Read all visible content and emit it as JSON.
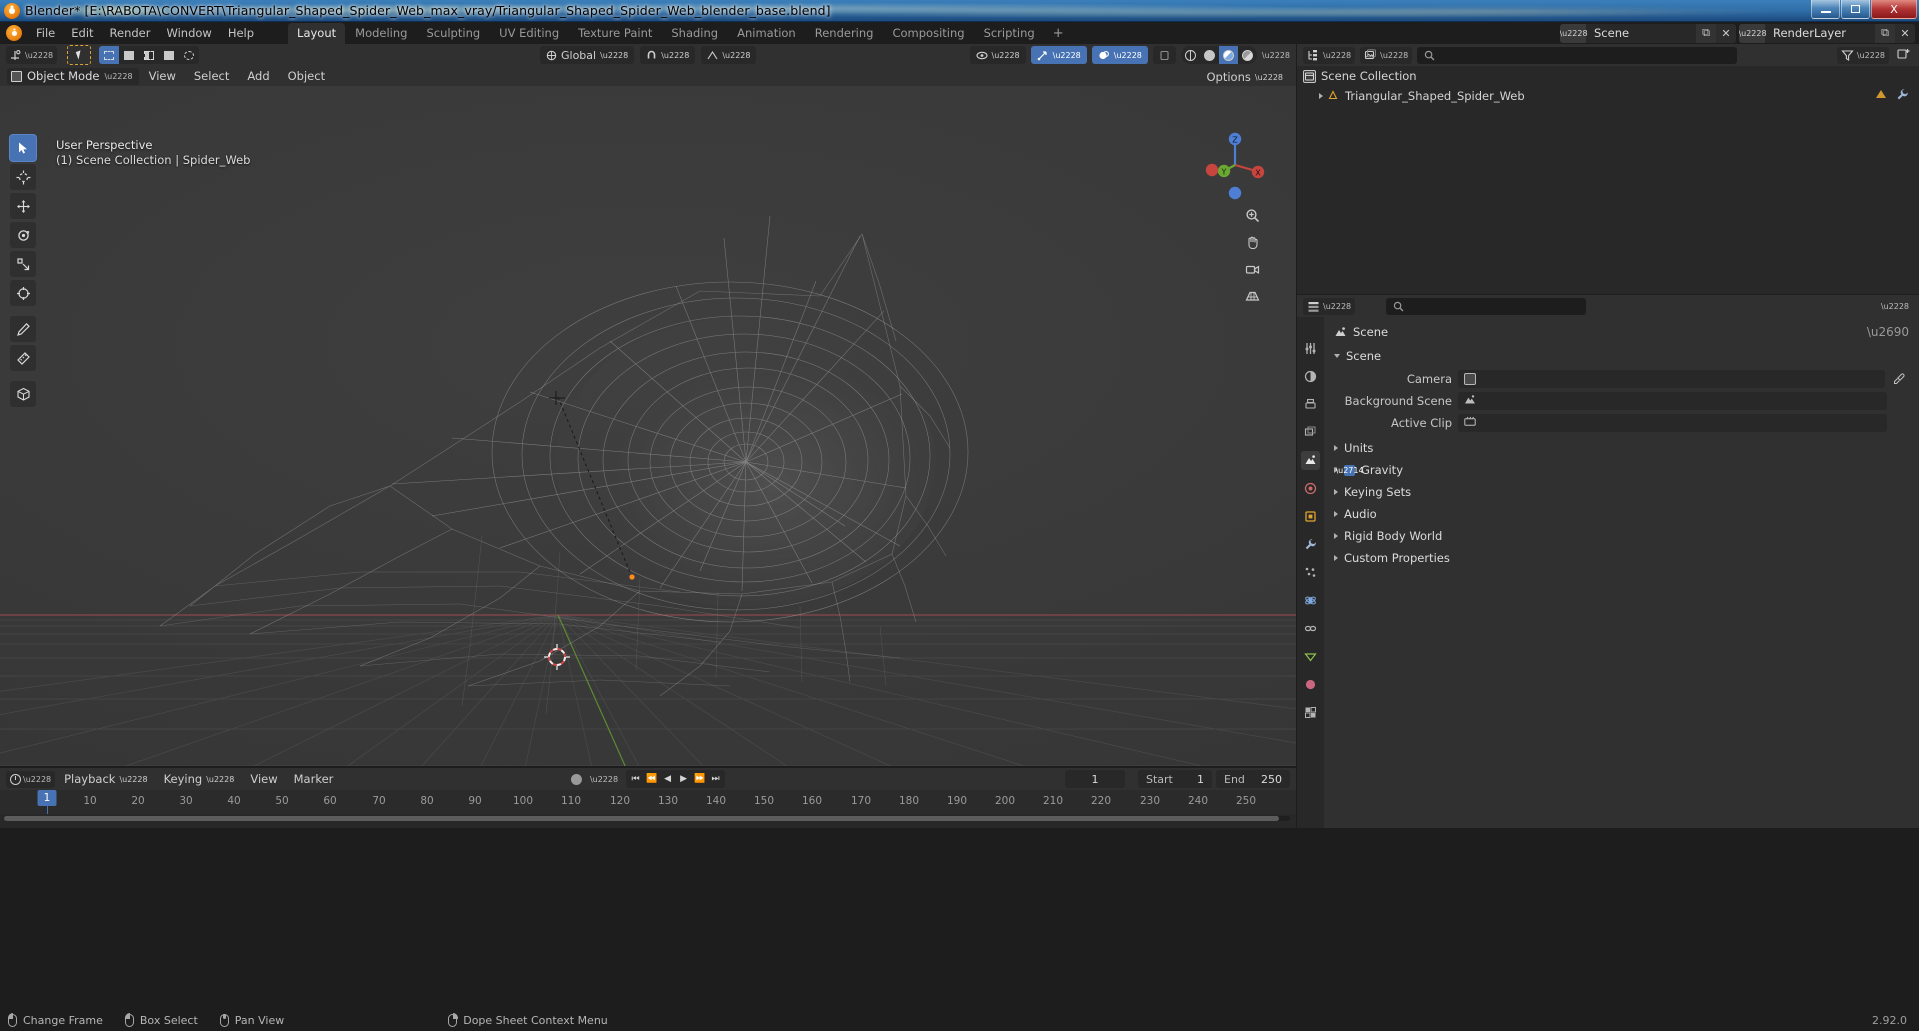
{
  "window": {
    "title": "Blender* [E:\\RABOTA\\CONVERT\\Triangular_Shaped_Spider_Web_max_vray/Triangular_Shaped_Spider_Web_blender_base.blend]",
    "minimize_label": "–",
    "maximize_label": "□",
    "close_label": "X",
    "accent": "#4772b3"
  },
  "topbar": {
    "menus": [
      "File",
      "Edit",
      "Render",
      "Window",
      "Help"
    ],
    "workspaces": [
      {
        "label": "Layout",
        "active": true
      },
      {
        "label": "Modeling",
        "active": false
      },
      {
        "label": "Sculpting",
        "active": false
      },
      {
        "label": "UV Editing",
        "active": false
      },
      {
        "label": "Texture Paint",
        "active": false
      },
      {
        "label": "Shading",
        "active": false
      },
      {
        "label": "Animation",
        "active": false
      },
      {
        "label": "Rendering",
        "active": false
      },
      {
        "label": "Compositing",
        "active": false
      },
      {
        "label": "Scripting",
        "active": false
      }
    ],
    "add_workspace": "+",
    "scene_name": "Scene",
    "view_layer_name": "RenderLayer",
    "new_label": "⧉",
    "unlink_label": "✕"
  },
  "viewport": {
    "mode": "Object Mode",
    "menus": [
      "View",
      "Select",
      "Add",
      "Object"
    ],
    "transform_orientation": "Global",
    "options_label": "Options",
    "overlay_line1": "User Perspective",
    "overlay_line2": "(1) Scene Collection | Spider_Web",
    "gizmo_axes": [
      "X",
      "Y",
      "Z"
    ],
    "tools": [
      {
        "name": "tweak",
        "active": true
      },
      {
        "name": "cursor",
        "active": false
      },
      {
        "name": "move",
        "active": false
      },
      {
        "name": "rotate",
        "active": false
      },
      {
        "name": "scale",
        "active": false
      },
      {
        "name": "transform",
        "active": false
      },
      {
        "name": "annotate",
        "active": false
      },
      {
        "name": "measure",
        "active": false
      },
      {
        "name": "add-cube",
        "active": false
      }
    ],
    "shading_modes": [
      "wireframe",
      "solid",
      "material",
      "rendered"
    ],
    "shading_active": "material"
  },
  "outliner": {
    "search_placeholder": "",
    "rows": [
      {
        "label": "Scene Collection",
        "depth": 0,
        "icon": "collection-icon"
      },
      {
        "label": "Triangular_Shaped_Spider_Web",
        "depth": 1,
        "icon": "mesh-data-icon"
      }
    ]
  },
  "properties": {
    "breadcrumb": "Scene",
    "panel_title": "Scene",
    "rows": [
      {
        "label": "Camera",
        "value": "",
        "icon": "camera-icon",
        "eyedropper": true
      },
      {
        "label": "Background Scene",
        "value": "",
        "icon": "scene-icon",
        "eyedropper": false
      },
      {
        "label": "Active Clip",
        "value": "",
        "icon": "clip-icon",
        "eyedropper": false
      }
    ],
    "sections": [
      {
        "label": "Units",
        "open": false,
        "checkbox": null
      },
      {
        "label": "Gravity",
        "open": false,
        "checkbox": true
      },
      {
        "label": "Keying Sets",
        "open": false,
        "checkbox": null
      },
      {
        "label": "Audio",
        "open": false,
        "checkbox": null
      },
      {
        "label": "Rigid Body World",
        "open": false,
        "checkbox": null
      },
      {
        "label": "Custom Properties",
        "open": false,
        "checkbox": null
      }
    ],
    "tabs": [
      {
        "name": "tool-tab",
        "glyph": "⚒",
        "active": false
      },
      {
        "name": "render-tab",
        "glyph": "◴",
        "active": false
      },
      {
        "name": "output-tab",
        "glyph": "⎙",
        "active": false
      },
      {
        "name": "view-layer-tab",
        "glyph": "☰",
        "active": false
      },
      {
        "name": "scene-tab",
        "glyph": "▲",
        "active": true
      },
      {
        "name": "world-tab",
        "glyph": "◉",
        "active": false
      },
      {
        "name": "object-tab",
        "glyph": "▣",
        "active": false
      },
      {
        "name": "modifier-tab",
        "glyph": "🔧",
        "active": false
      },
      {
        "name": "particle-tab",
        "glyph": "⁂",
        "active": false
      },
      {
        "name": "physics-tab",
        "glyph": "◌",
        "active": false
      },
      {
        "name": "constraint-tab",
        "glyph": "⛓",
        "active": false
      },
      {
        "name": "data-tab",
        "glyph": "▽",
        "active": false
      },
      {
        "name": "material-tab",
        "glyph": "●",
        "active": false
      },
      {
        "name": "texture-tab",
        "glyph": "░",
        "active": false
      }
    ]
  },
  "timeline": {
    "playback_label": "Playback",
    "keying_label": "Keying",
    "view_label": "View",
    "marker_label": "Marker",
    "current_frame": "1",
    "start_key": "Start",
    "start_value": "1",
    "end_key": "End",
    "end_value": "250",
    "ticks": [
      "10",
      "20",
      "30",
      "40",
      "50",
      "60",
      "70",
      "80",
      "90",
      "100",
      "110",
      "120",
      "130",
      "140",
      "150",
      "160",
      "170",
      "180",
      "190",
      "200",
      "210",
      "220",
      "230",
      "240",
      "250"
    ],
    "playhead_frame": "1",
    "transport": [
      "⏮",
      "⏪",
      "◀",
      "▶",
      "⏩",
      "⏭"
    ]
  },
  "statusbar": {
    "items": [
      {
        "icon": "mouse-left-icon",
        "label": "Change Frame"
      },
      {
        "icon": "mouse-left-icon",
        "label": "Box Select"
      },
      {
        "icon": "mouse-middle-icon",
        "label": "Pan View"
      },
      {
        "icon": "mouse-right-icon",
        "label": "Dope Sheet Context Menu"
      }
    ],
    "version": "2.92.0"
  }
}
